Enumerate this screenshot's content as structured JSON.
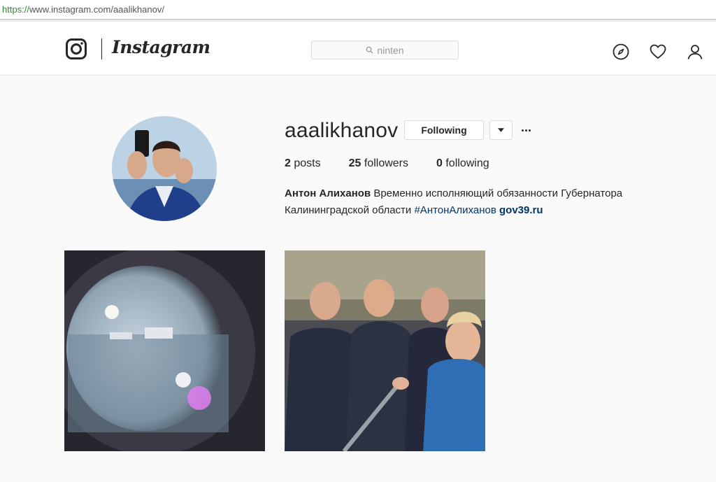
{
  "browser": {
    "url_scheme": "https://",
    "url_rest": "www.instagram.com/aaalikhanov/"
  },
  "header": {
    "logo_text": "Instagram",
    "search_value": "ninten",
    "icons": [
      "explore-icon",
      "heart-icon",
      "profile-icon"
    ]
  },
  "profile": {
    "username": "aaalikhanov",
    "follow_label": "Following",
    "posts_count": "2",
    "posts_label": "posts",
    "followers_count": "25",
    "followers_label": "followers",
    "following_count": "0",
    "following_label": "following",
    "full_name": "Антон Алиханов",
    "bio_text": "Временно исполняющий обязанности Губернатора Калининградской области",
    "hashtag": "#АнтонАлиханов",
    "website": "gov39.ru"
  },
  "posts": [
    {
      "description": "sea-through-lens"
    },
    {
      "description": "group-selfie"
    }
  ],
  "colors": {
    "link": "#003569",
    "border": "#dbdbdb",
    "background": "#fafafa"
  }
}
